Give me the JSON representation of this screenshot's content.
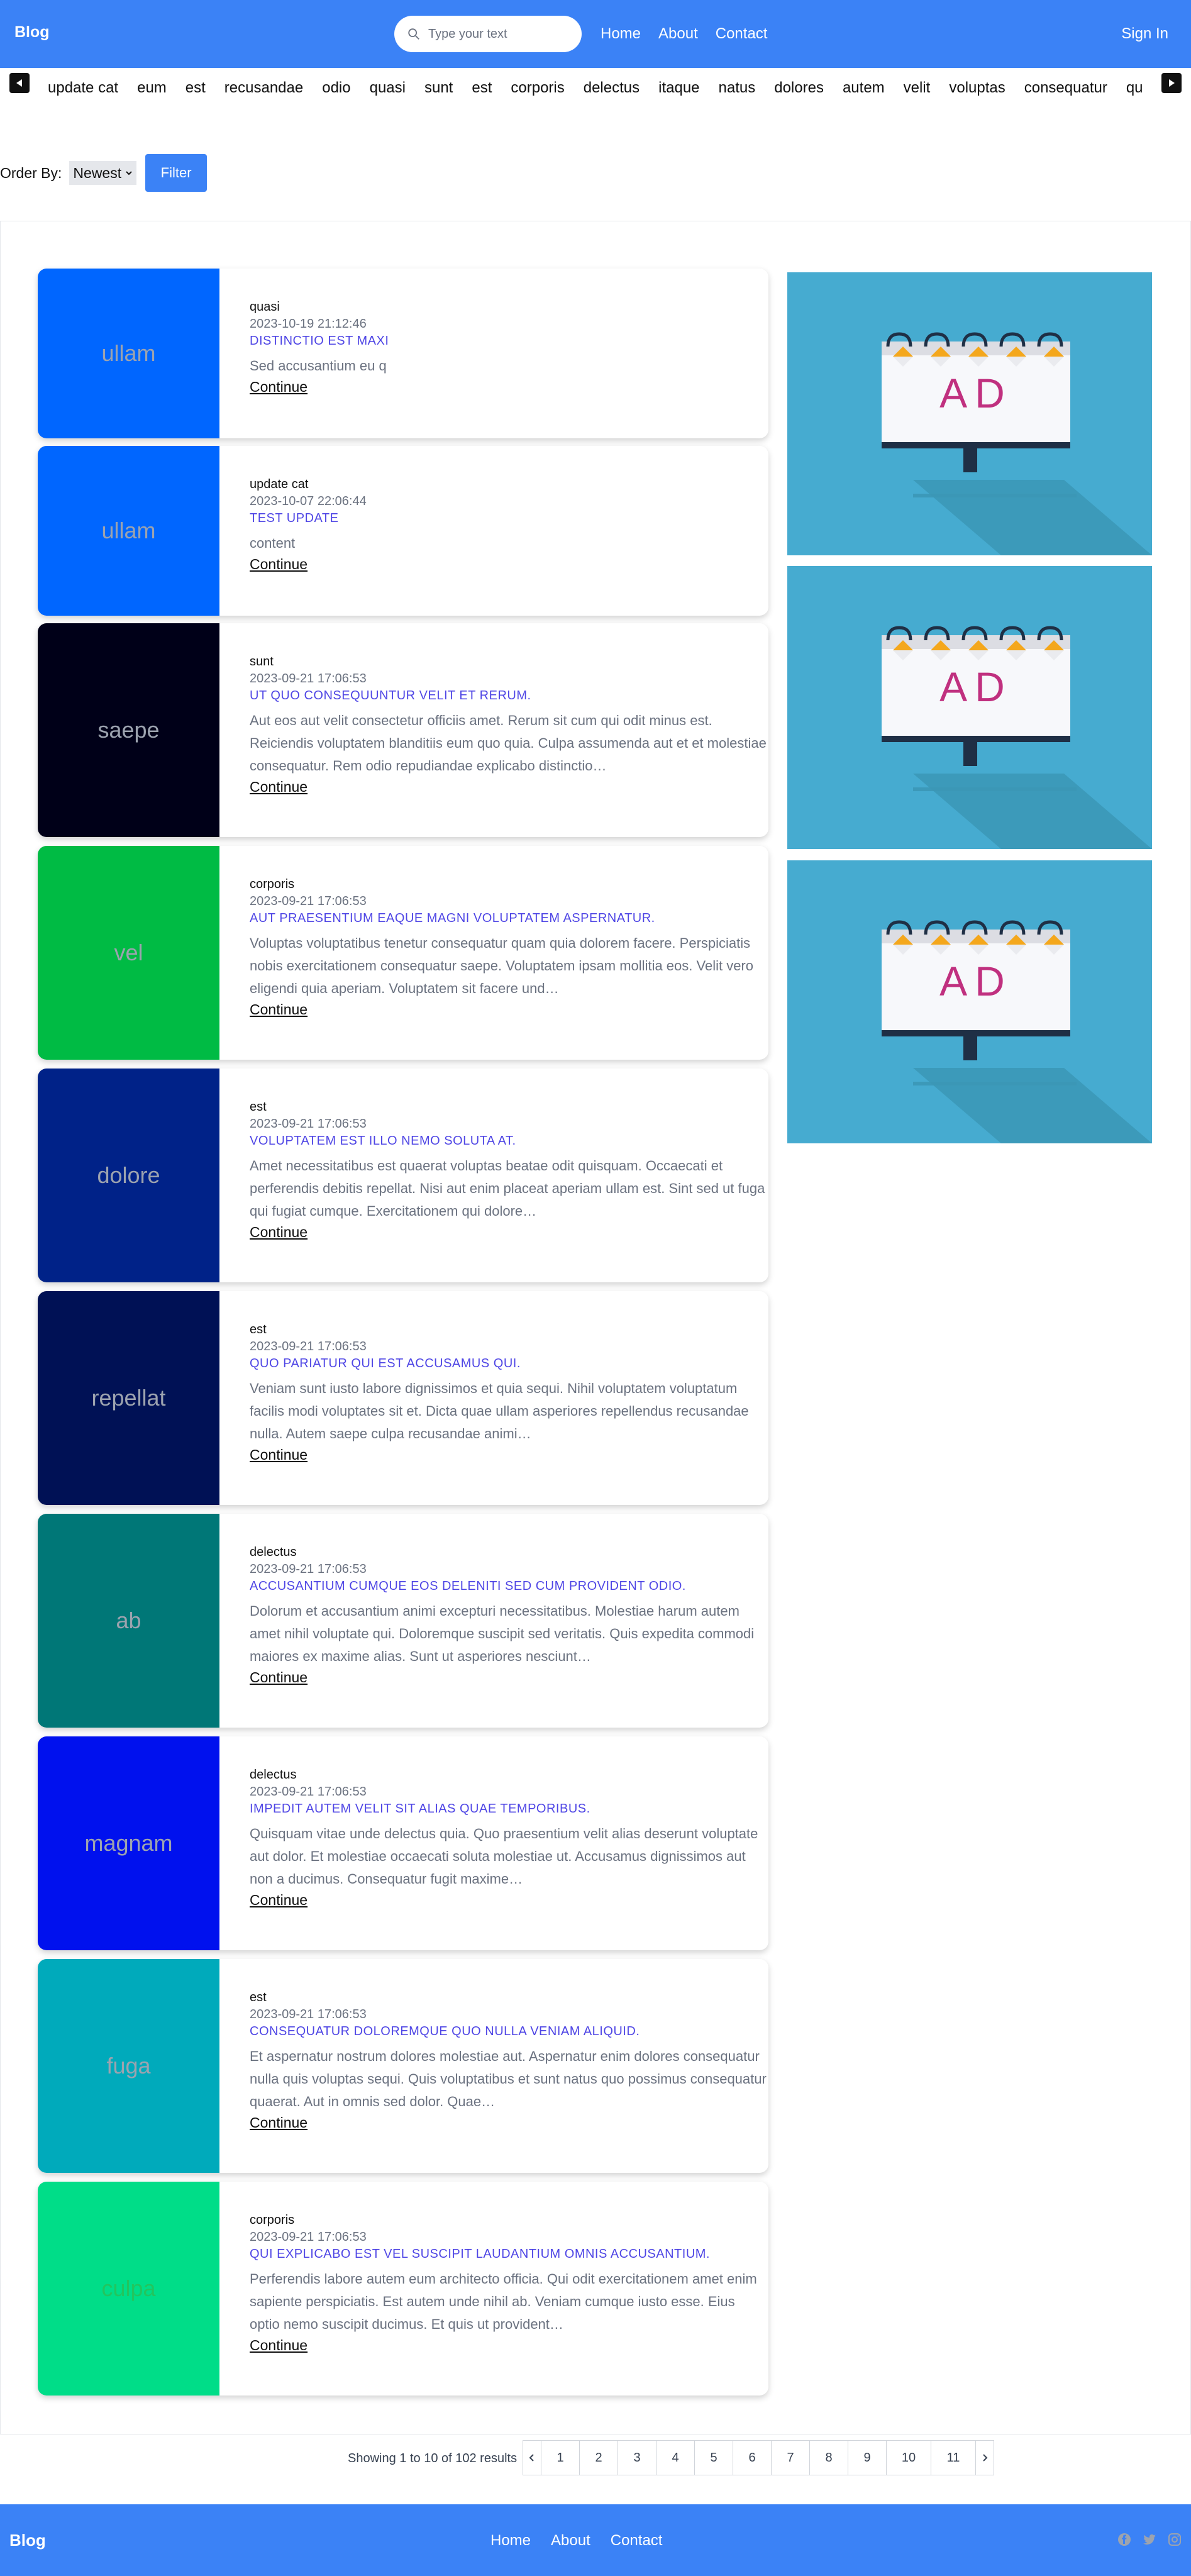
{
  "header": {
    "brand": "Blog",
    "search_placeholder": "Type your text",
    "nav": [
      "Home",
      "About",
      "Contact"
    ],
    "signin": "Sign In"
  },
  "tags": [
    "update cat",
    "eum",
    "est",
    "recusandae",
    "odio",
    "quasi",
    "sunt",
    "est",
    "corporis",
    "delectus",
    "itaque",
    "natus",
    "dolores",
    "autem",
    "velit",
    "voluptas",
    "consequatur",
    "quo"
  ],
  "order": {
    "label": "Order By:",
    "value": "Newest",
    "filter_label": "Filter"
  },
  "posts": [
    {
      "thumb": "ullam",
      "color": "#0066ff",
      "text_color": "#9ca3af",
      "category": "quasi",
      "date": "2023-10-19 21:12:46",
      "title": "DISTINCTIO EST MAXI",
      "excerpt": "Sed accusantium eu q",
      "more": "Continue"
    },
    {
      "thumb": "ullam",
      "color": "#0066ff",
      "text_color": "#9ca3af",
      "category": "update cat",
      "date": "2023-10-07 22:06:44",
      "title": "TEST UPDATE",
      "excerpt": "content",
      "more": "Continue"
    },
    {
      "thumb": "saepe",
      "color": "#000018",
      "text_color": "#9ca3af",
      "category": "sunt",
      "date": "2023-09-21 17:06:53",
      "title": "UT QUO CONSEQUUNTUR VELIT ET RERUM.",
      "excerpt": "Aut eos aut velit consectetur officiis amet. Rerum sit cum qui odit minus est. Reiciendis voluptatem blanditiis eum quo quia. Culpa assumenda aut et et molestiae consequatur. Rem odio repudiandae explicabo distinctio…",
      "more": "Continue"
    },
    {
      "thumb": "vel",
      "color": "#00bb44",
      "text_color": "#9ca3af",
      "category": "corporis",
      "date": "2023-09-21 17:06:53",
      "title": "AUT PRAESENTIUM EAQUE MAGNI VOLUPTATEM ASPERNATUR.",
      "excerpt": "Voluptas voluptatibus tenetur consequatur quam quia dolorem facere. Perspiciatis nobis exercitationem consequatur saepe. Voluptatem ipsam mollitia eos. Velit vero eligendi quia aperiam. Voluptatem sit facere und…",
      "more": "Continue"
    },
    {
      "thumb": "dolore",
      "color": "#002288",
      "text_color": "#9ca3af",
      "category": "est",
      "date": "2023-09-21 17:06:53",
      "title": "VOLUPTATEM EST ILLO NEMO SOLUTA AT.",
      "excerpt": "Amet necessitatibus est quaerat voluptas beatae odit quisquam. Occaecati et perferendis debitis repellat. Nisi aut enim placeat aperiam ullam est. Sint sed ut fuga qui fugiat cumque. Exercitationem qui dolore…",
      "more": "Continue"
    },
    {
      "thumb": "repellat",
      "color": "#001155",
      "text_color": "#9ca3af",
      "category": "est",
      "date": "2023-09-21 17:06:53",
      "title": "QUO PARIATUR QUI EST ACCUSAMUS QUI.",
      "excerpt": "Veniam sunt iusto labore dignissimos et quia sequi. Nihil voluptatem voluptatum facilis modi voluptates sit et. Dicta quae ullam asperiores repellendus recusandae nulla. Autem saepe culpa recusandae animi…",
      "more": "Continue"
    },
    {
      "thumb": "ab",
      "color": "#007777",
      "text_color": "#9ca3af",
      "category": "delectus",
      "date": "2023-09-21 17:06:53",
      "title": "ACCUSANTIUM CUMQUE EOS DELENITI SED CUM PROVIDENT ODIO.",
      "excerpt": "Dolorum et accusantium animi excepturi necessitatibus. Molestiae harum autem amet nihil voluptate qui. Doloremque suscipit sed veritatis. Quis expedita commodi maiores ex maxime alias. Sunt ut asperiores nesciunt…",
      "more": "Continue"
    },
    {
      "thumb": "magnam",
      "color": "#0011ee",
      "text_color": "#9ca3af",
      "category": "delectus",
      "date": "2023-09-21 17:06:53",
      "title": "IMPEDIT AUTEM VELIT SIT ALIAS QUAE TEMPORIBUS.",
      "excerpt": "Quisquam vitae unde delectus quia. Quo praesentium velit alias deserunt voluptate aut dolor. Et molestiae occaecati soluta molestiae ut. Accusamus dignissimos aut non a ducimus. Consequatur fugit maxime…",
      "more": "Continue"
    },
    {
      "thumb": "fuga",
      "color": "#00aabb",
      "text_color": "#9ca3af",
      "category": "est",
      "date": "2023-09-21 17:06:53",
      "title": "CONSEQUATUR DOLOREMQUE QUO NULLA VENIAM ALIQUID.",
      "excerpt": "Et aspernatur nostrum dolores molestiae aut. Aspernatur enim dolores consequatur nulla quis voluptas sequi. Quis voluptatibus et sunt natus quo possimus consequatur quaerat. Aut in omnis sed dolor. Quae…",
      "more": "Continue"
    },
    {
      "thumb": "culpa",
      "color": "#00dd88",
      "text_color": "#22c55e",
      "category": "corporis",
      "date": "2023-09-21 17:06:53",
      "title": "QUI EXPLICABO EST VEL SUSCIPIT LAUDANTIUM OMNIS ACCUSANTIUM.",
      "excerpt": "Perferendis labore autem eum architecto officia. Qui odit exercitationem amet enim sapiente perspiciatis. Est autem unde nihil ab. Veniam cumque iusto esse. Eius optio nemo suscipit ducimus. Et quis ut provident…",
      "more": "Continue"
    }
  ],
  "ads": [
    {
      "label": "AD"
    },
    {
      "label": "AD"
    },
    {
      "label": "AD"
    }
  ],
  "pagination": {
    "showing": "Showing 1 to 10 of 102 results",
    "pages": [
      "1",
      "2",
      "3",
      "4",
      "5",
      "6",
      "7",
      "8",
      "9",
      "10",
      "11"
    ]
  },
  "footer": {
    "brand": "Blog",
    "nav": [
      "Home",
      "About",
      "Contact"
    ],
    "socials": [
      "facebook-icon",
      "twitter-icon",
      "instagram-icon"
    ]
  },
  "colors": {
    "primary": "#3b82f6",
    "title": "#4f46e5",
    "ad_bg": "#46abd0",
    "ad_text": "#c0307f"
  }
}
